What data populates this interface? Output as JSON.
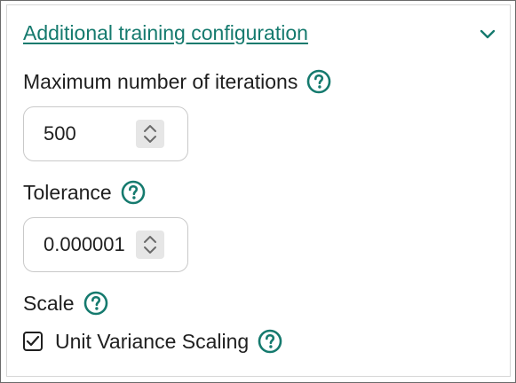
{
  "section": {
    "title": "Additional training configuration",
    "expanded": true,
    "chevron_icon": "chevron-down-icon"
  },
  "fields": {
    "max_iterations": {
      "label": "Maximum number of iterations",
      "value": "500",
      "help_icon": "question-circle-icon"
    },
    "tolerance": {
      "label": "Tolerance",
      "value": "0.000001",
      "help_icon": "question-circle-icon"
    },
    "scale": {
      "label": "Scale",
      "help_icon": "question-circle-icon",
      "checkbox_label": "Unit Variance Scaling",
      "checked": true
    }
  },
  "colors": {
    "accent": "#157a6e",
    "text": "#1f1f1f",
    "border": "#c9c9c9",
    "spinner_bg": "#e6e6e6"
  }
}
